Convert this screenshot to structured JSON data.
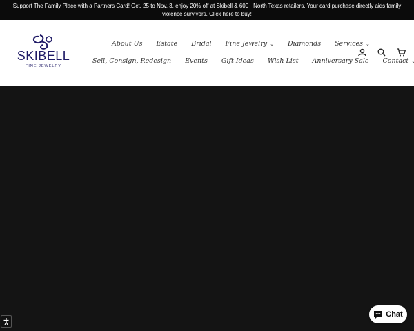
{
  "announcement": {
    "text": "Support The Family Place with a Partners Card! Oct. 25 to Nov. 3, enjoy 20% off at Skibell & 600+ North Texas retailers. Your card purchase directly aids family violence survivors. Click here to buy!"
  },
  "logo": {
    "brand": "SKIBELL",
    "subtitle": "FINE JEWELRY",
    "color": "#1f1a66"
  },
  "nav": {
    "row1": [
      {
        "label": "About Us",
        "dropdown": false
      },
      {
        "label": "Estate",
        "dropdown": false
      },
      {
        "label": "Bridal",
        "dropdown": false
      },
      {
        "label": "Fine Jewelry",
        "dropdown": true
      },
      {
        "label": "Diamonds",
        "dropdown": false
      },
      {
        "label": "Services",
        "dropdown": true
      }
    ],
    "row2": [
      {
        "label": "Sell, Consign, Redesign",
        "dropdown": false
      },
      {
        "label": "Events",
        "dropdown": false
      },
      {
        "label": "Gift Ideas",
        "dropdown": false
      },
      {
        "label": "Wish List",
        "dropdown": false
      },
      {
        "label": "Anniversary Sale",
        "dropdown": false
      },
      {
        "label": "Contact",
        "dropdown": true
      }
    ]
  },
  "header_icons": [
    "account-icon",
    "search-icon",
    "cart-icon"
  ],
  "chat": {
    "label": "Chat"
  },
  "colors": {
    "announcement_bg": "#0b0b0b",
    "hero_bg": "#141414",
    "brand": "#1f1a66"
  }
}
